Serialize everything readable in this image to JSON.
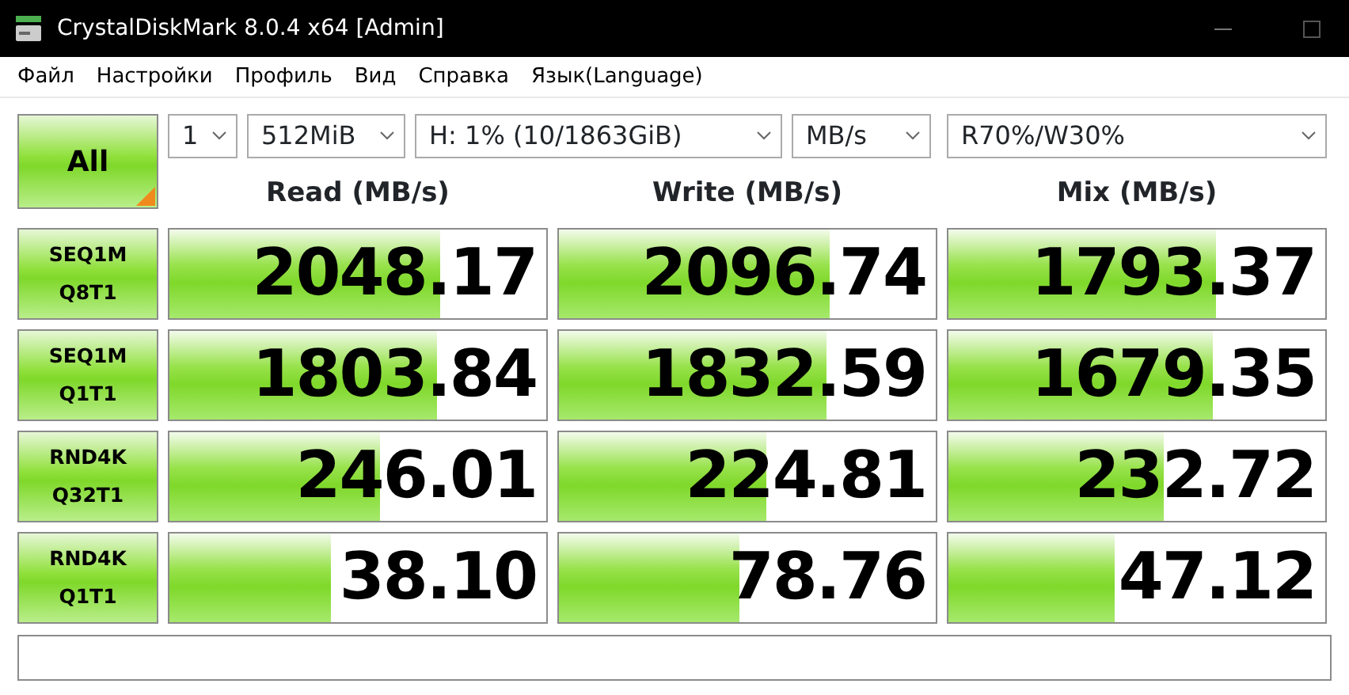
{
  "window": {
    "title": "CrystalDiskMark 8.0.4 x64 [Admin]"
  },
  "menu": [
    "Файл",
    "Настройки",
    "Профиль",
    "Вид",
    "Справка",
    "Язык(Language)"
  ],
  "all_button": {
    "label": "All"
  },
  "selectors": [
    {
      "value": "1"
    },
    {
      "value": "512MiB"
    },
    {
      "value": "H: 1% (10/1863GiB)"
    },
    {
      "value": "MB/s"
    },
    {
      "value": "R70%/W30%"
    }
  ],
  "columns": [
    "Read (MB/s)",
    "Write (MB/s)",
    "Mix (MB/s)"
  ],
  "tests": [
    {
      "line1": "SEQ1M",
      "line2": "Q8T1",
      "results": [
        {
          "value": "2048.17",
          "level": 0.72
        },
        {
          "value": "2096.74",
          "level": 0.72
        },
        {
          "value": "1793.37",
          "level": 0.71
        }
      ]
    },
    {
      "line1": "SEQ1M",
      "line2": "Q1T1",
      "results": [
        {
          "value": "1803.84",
          "level": 0.71
        },
        {
          "value": "1832.59",
          "level": 0.71
        },
        {
          "value": "1679.35",
          "level": 0.7
        }
      ]
    },
    {
      "line1": "RND4K",
      "line2": "Q32T1",
      "results": [
        {
          "value": "246.01",
          "level": 0.56
        },
        {
          "value": "224.81",
          "level": 0.55
        },
        {
          "value": "232.72",
          "level": 0.57
        }
      ]
    },
    {
      "line1": "RND4K",
      "line2": "Q1T1",
      "results": [
        {
          "value": "38.10",
          "level": 0.43
        },
        {
          "value": "78.76",
          "level": 0.48
        },
        {
          "value": "47.12",
          "level": 0.44
        }
      ]
    }
  ]
}
